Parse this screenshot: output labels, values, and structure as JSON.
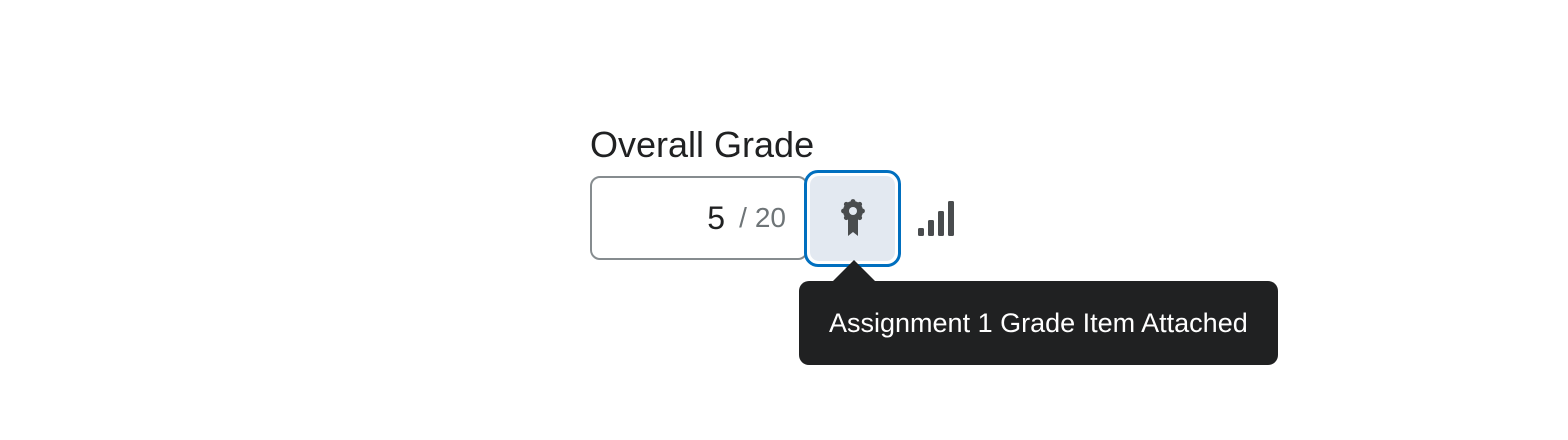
{
  "grade": {
    "label": "Overall Grade",
    "score": "5",
    "separator": "/",
    "max": "20"
  },
  "grade_item_button": {
    "icon": "award-ribbon-icon",
    "tooltip": "Assignment 1 Grade Item Attached"
  },
  "stats_button": {
    "icon": "bar-chart-icon"
  },
  "colors": {
    "focus_ring": "#006fbf",
    "button_fill": "#e3e9f1",
    "tooltip_bg": "#202122",
    "text": "#202122",
    "muted_text": "#6e7477"
  }
}
